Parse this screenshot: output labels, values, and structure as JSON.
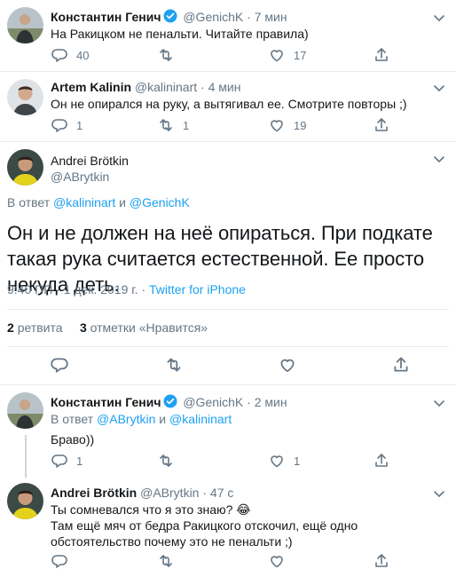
{
  "tweets": [
    {
      "name": "Константин Генич",
      "handle": "@GenichK",
      "dot": "·",
      "time": "7 мин",
      "verified": true,
      "text": "На Ракицком не пенальти. Читайте правила)",
      "reply_count": "40",
      "retweet_count": "",
      "like_count": "17"
    },
    {
      "name": "Artem Kalinin",
      "handle": "@kalininart",
      "dot": "·",
      "time": "4 мин",
      "verified": false,
      "text": "Он не опирался на руку, а вытягивал ее. Смотрите повторы ;)",
      "reply_count": "1",
      "retweet_count": "1",
      "like_count": "19"
    }
  ],
  "main_tweet": {
    "name": "Andrei Brötkin",
    "handle": "@ABrytkin",
    "reply_prefix": "В ответ",
    "reply_user1": "@kalininart",
    "reply_and": "и",
    "reply_user2": "@GenichK",
    "text": "Он и не должен на неё опираться. При подкате такая рука считается естественной. Ее просто некуда деть.",
    "timestamp": "9:40 ПП · 1 дек. 2019 г. ·",
    "source": "Twitter for iPhone",
    "retweets_count": "2",
    "retweets_label": "ретвита",
    "likes_count": "3",
    "likes_label": "отметки «Нравится»"
  },
  "replies": [
    {
      "name": "Константин Генич",
      "handle": "@GenichK",
      "dot": "·",
      "time": "2 мин",
      "verified": true,
      "reply_prefix": "В ответ",
      "reply_user1": "@ABrytkin",
      "reply_and": "и",
      "reply_user2": "@kalininart",
      "text": "Браво))",
      "reply_count": "1",
      "retweet_count": "",
      "like_count": "1"
    },
    {
      "name": "Andrei Brötkin",
      "handle": "@ABrytkin",
      "dot": "·",
      "time": "47 с",
      "verified": false,
      "text_line1": "Ты сомневался что я это знаю? 😂",
      "text_line2": "Там ещё мяч от бедра Ракицкого отскочил, ещё одно обстоятельство почему это не пенальти ;)",
      "reply_count": "",
      "retweet_count": "",
      "like_count": ""
    }
  ],
  "colors": {
    "accent": "#1da1f2",
    "secondary_text": "#657786",
    "divider": "#e6ecf0"
  },
  "icons": [
    "reply-icon",
    "retweet-icon",
    "like-icon",
    "share-icon",
    "verified-icon",
    "chevron-down-icon"
  ]
}
